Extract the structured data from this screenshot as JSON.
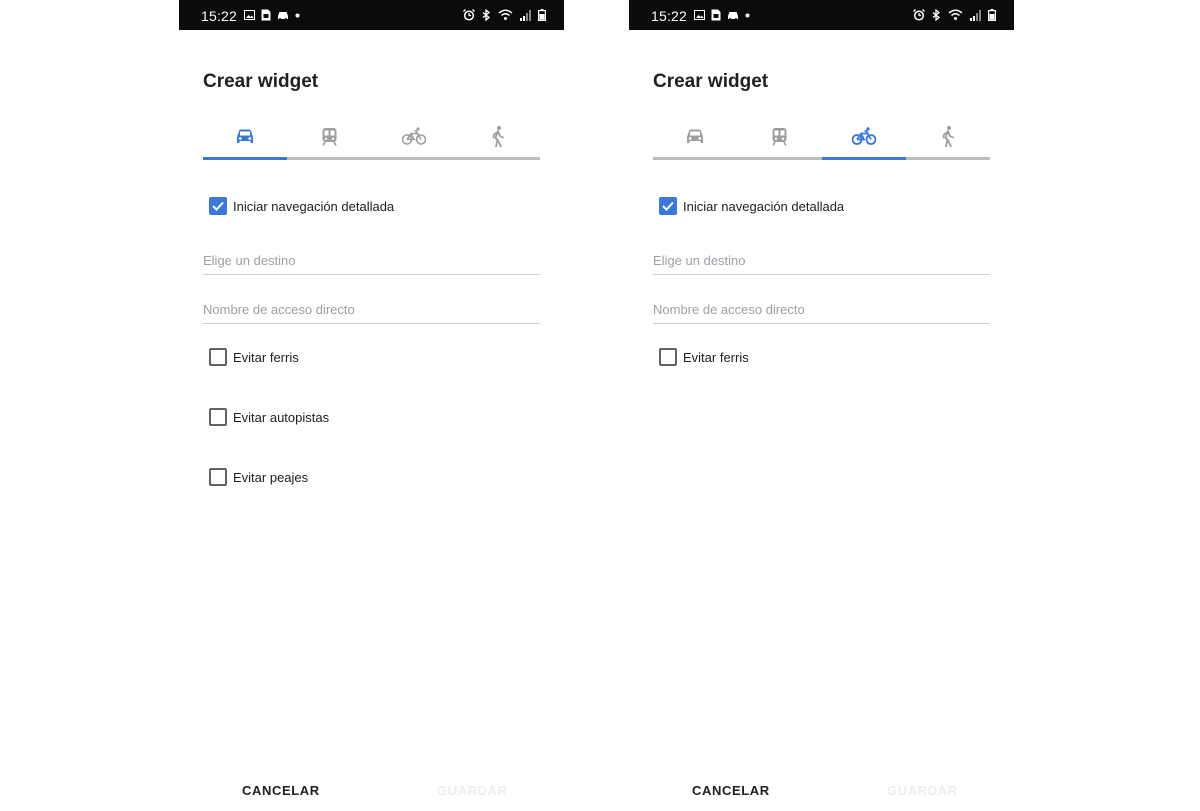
{
  "statusbar": {
    "time": "15:22",
    "left_icons": [
      "image-icon",
      "sim-card-icon",
      "car-notification-icon",
      "dot-icon"
    ],
    "right_icons": [
      "alarm-icon",
      "bluetooth-icon",
      "wifi-icon",
      "signal-icon",
      "battery-icon"
    ]
  },
  "colors": {
    "accent": "#3b78d8",
    "inactive_icon": "#9e9e9e",
    "tab_track": "#bdbdbd",
    "status_bar": "#0b0b0b"
  },
  "screens": [
    {
      "title": "Crear widget",
      "tabs": [
        {
          "icon": "car-icon",
          "active": true
        },
        {
          "icon": "train-icon",
          "active": false
        },
        {
          "icon": "bicycle-icon",
          "active": false
        },
        {
          "icon": "walking-icon",
          "active": false
        }
      ],
      "turn_by_turn": {
        "label": "Iniciar navegación detallada",
        "checked": true
      },
      "destination_placeholder": "Elige un destino",
      "shortcut_placeholder": "Nombre de acceso directo",
      "options": [
        {
          "label": "Evitar ferris",
          "checked": false
        },
        {
          "label": "Evitar autopistas",
          "checked": false
        },
        {
          "label": "Evitar peajes",
          "checked": false
        }
      ],
      "cancel_label": "CANCELAR",
      "save_label": "GUARDAR"
    },
    {
      "title": "Crear widget",
      "tabs": [
        {
          "icon": "car-icon",
          "active": false
        },
        {
          "icon": "train-icon",
          "active": false
        },
        {
          "icon": "bicycle-icon",
          "active": true
        },
        {
          "icon": "walking-icon",
          "active": false
        }
      ],
      "turn_by_turn": {
        "label": "Iniciar navegación detallada",
        "checked": true
      },
      "destination_placeholder": "Elige un destino",
      "shortcut_placeholder": "Nombre de acceso directo",
      "options": [
        {
          "label": "Evitar ferris",
          "checked": false
        }
      ],
      "cancel_label": "CANCELAR",
      "save_label": "GUARDAR"
    }
  ]
}
